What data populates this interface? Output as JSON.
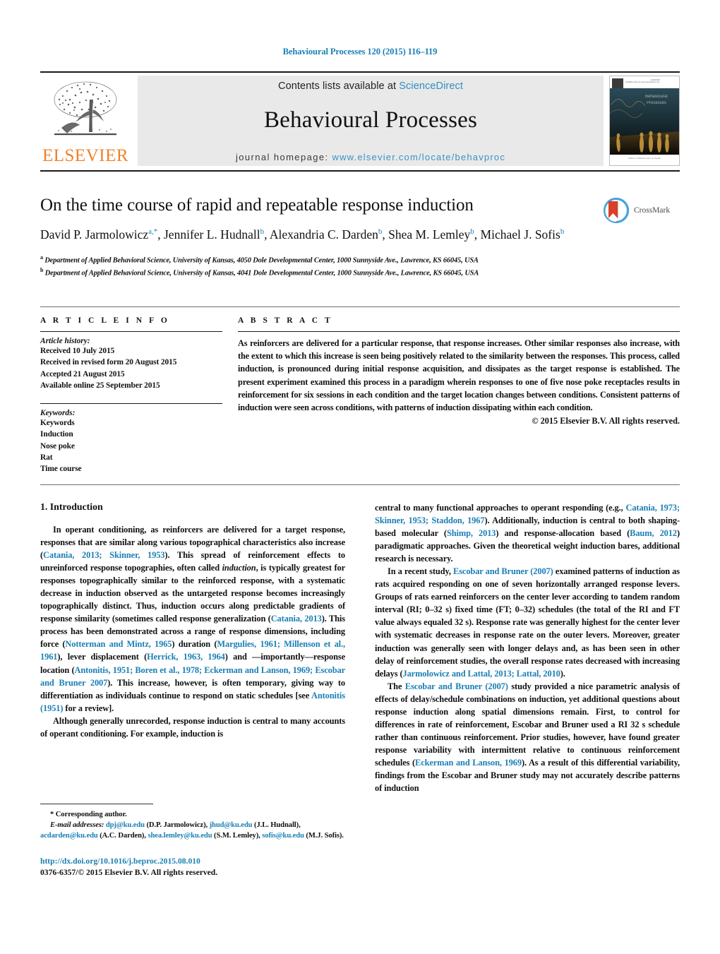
{
  "running_head": "Behavioural Processes 120 (2015) 116–119",
  "masthead": {
    "contents_prefix": "Contents lists available at ",
    "contents_link": "ScienceDirect",
    "journal_title": "Behavioural Processes",
    "homepage_prefix": "journal homepage: ",
    "homepage_url": "www.elsevier.com/locate/behavproc",
    "publisher_name": "ELSEVIER",
    "cover_journal_title": "Behavioural Processes"
  },
  "article": {
    "title": "On the time course of rapid and repeatable response induction",
    "authors_html": "David P. Jarmolowicz<sup>a,*</sup>, Jennifer L. Hudnall<sup>b</sup>, Alexandria C. Darden<sup>b</sup>, Shea M. Lemley<sup>b</sup>, Michael J. Sofis<sup>b</sup>",
    "affiliations": [
      "a Department of Applied Behavioral Science, University of Kansas, 4050 Dole Developmental Center, 1000 Sunnyside Ave., Lawrence, KS 66045, USA",
      "b Department of Applied Behavioral Science, University of Kansas, 4041 Dole Developmental Center, 1000 Sunnyside Ave., Lawrence, KS 66045, USA"
    ],
    "crossmark_label": "CrossMark"
  },
  "article_info": {
    "heading": "A R T I C L E   I N F O",
    "history_label": "Article history:",
    "history": [
      "Received 10 July 2015",
      "Received in revised form 20 August 2015",
      "Accepted 21 August 2015",
      "Available online 25 September 2015"
    ],
    "keywords_label": "Keywords:",
    "keywords": [
      "Keywords",
      "Induction",
      "Nose poke",
      "Rat",
      "Time course"
    ]
  },
  "abstract": {
    "heading": "A B S T R A C T",
    "text": "As reinforcers are delivered for a particular response, that response increases. Other similar responses also increase, with the extent to which this increase is seen being positively related to the similarity between the responses. This process, called induction, is pronounced during initial response acquisition, and dissipates as the target response is established. The present experiment examined this process in a paradigm wherein responses to one of five nose poke receptacles results in reinforcement for six sessions in each condition and the target location changes between conditions. Consistent patterns of induction were seen across conditions, with patterns of induction dissipating within each condition.",
    "copyright": "© 2015 Elsevier B.V. All rights reserved."
  },
  "body": {
    "section_title": "1.  Introduction",
    "left_paragraphs": [
      "In operant conditioning, as reinforcers are delivered for a target response, responses that are similar along various topographical characteristics also increase (<span class=\"ref\">Catania, 2013; Skinner, 1953</span>). This spread of reinforcement effects to unreinforced response topographies, often called <i>induction</i>, is typically greatest for responses topographically similar to the reinforced response, with a systematic decrease in induction observed as the untargeted response becomes increasingly topographically distinct. Thus, induction occurs along predictable gradients of response similarity (sometimes called response generalization (<span class=\"ref\">Catania, 2013</span>). This process has been demonstrated across a range of response dimensions, including force (<span class=\"ref\">Notterman and Mintz, 1965</span>) duration (<span class=\"ref\">Margulies, 1961; Millenson et al., 1961</span>), lever displacement (<span class=\"ref\">Herrick, 1963, 1964</span>) and —importantly—response location (<span class=\"ref\">Antonitis, 1951; Boren et al., 1978; Eckerman and Lanson, 1969; Escobar and Bruner 2007</span>). This increase, however, is often temporary, giving way to differentiation as individuals continue to respond on static schedules [see <span class=\"ref\">Antonitis (1951)</span> for a review].",
      "Although generally unrecorded, response induction is central to many accounts of operant conditioning. For example, induction is"
    ],
    "right_paragraphs": [
      "central to many functional approaches to operant responding (e.g., <span class=\"ref\">Catania, 1973; Skinner, 1953; Staddon, 1967</span>). Additionally, induction is central to both shaping-based molecular (<span class=\"ref\">Shimp, 2013</span>) and response-allocation based (<span class=\"ref\">Baum, 2012</span>) paradigmatic approaches. Given the theoretical weight induction bares, additional research is necessary.",
      "In a recent study, <span class=\"ref\">Escobar and Bruner (2007)</span> examined patterns of induction as rats acquired responding on one of seven horizontally arranged response levers. Groups of rats earned reinforcers on the center lever according to tandem random interval (RI; 0–32 s) fixed time (FT; 0–32) schedules (the total of the RI and FT value always equaled 32 s). Response rate was generally highest for the center lever with systematic decreases in response rate on the outer levers. Moreover, greater induction was generally seen with longer delays and, as has been seen in other delay of reinforcement studies, the overall response rates decreased with increasing delays (<span class=\"ref\">Jarmolowicz and Lattal, 2013; Lattal, 2010</span>).",
      "The <span class=\"ref\">Escobar and Bruner (2007)</span> study provided a nice parametric analysis of effects of delay/schedule combinations on induction, yet additional questions about response induction along spatial dimensions remain. First, to control for differences in rate of reinforcement, Escobar and Bruner used a RI 32 s schedule rather than continuous reinforcement. Prior studies, however, have found greater response variability with intermittent relative to continuous reinforcement schedules (<span class=\"ref\">Eckerman and Lanson, 1969</span>). As a result of this differential variability, findings from the Escobar and Bruner study may not accurately describe patterns of induction"
    ]
  },
  "footnotes": {
    "corresponding": "* Corresponding author.",
    "emails_html": "<span class=\"em-lbl\">E-mail addresses:</span> <span class=\"ref\">dpj@ku.edu</span> (D.P. Jarmolowicz), <span class=\"ref\">jhud@ku.edu</span> (J.L. Hudnall), <span class=\"ref\">acdarden@ku.edu</span> (A.C. Darden), <span class=\"ref\">shea.lemley@ku.edu</span> (S.M. Lemley), <span class=\"ref\">sofis@ku.edu</span> (M.J. Sofis).",
    "doi": "http://dx.doi.org/10.1016/j.beproc.2015.08.010",
    "issn_line": "0376-6357/© 2015 Elsevier B.V. All rights reserved."
  },
  "colors": {
    "link": "#1a7fb5",
    "elsevier_orange": "#f0812a",
    "masthead_bg": "#e9e9e9",
    "sciencedirect_blue": "#2f8fc4",
    "crossmark_red": "#d9402a",
    "crossmark_blue": "#4aa3d8"
  }
}
